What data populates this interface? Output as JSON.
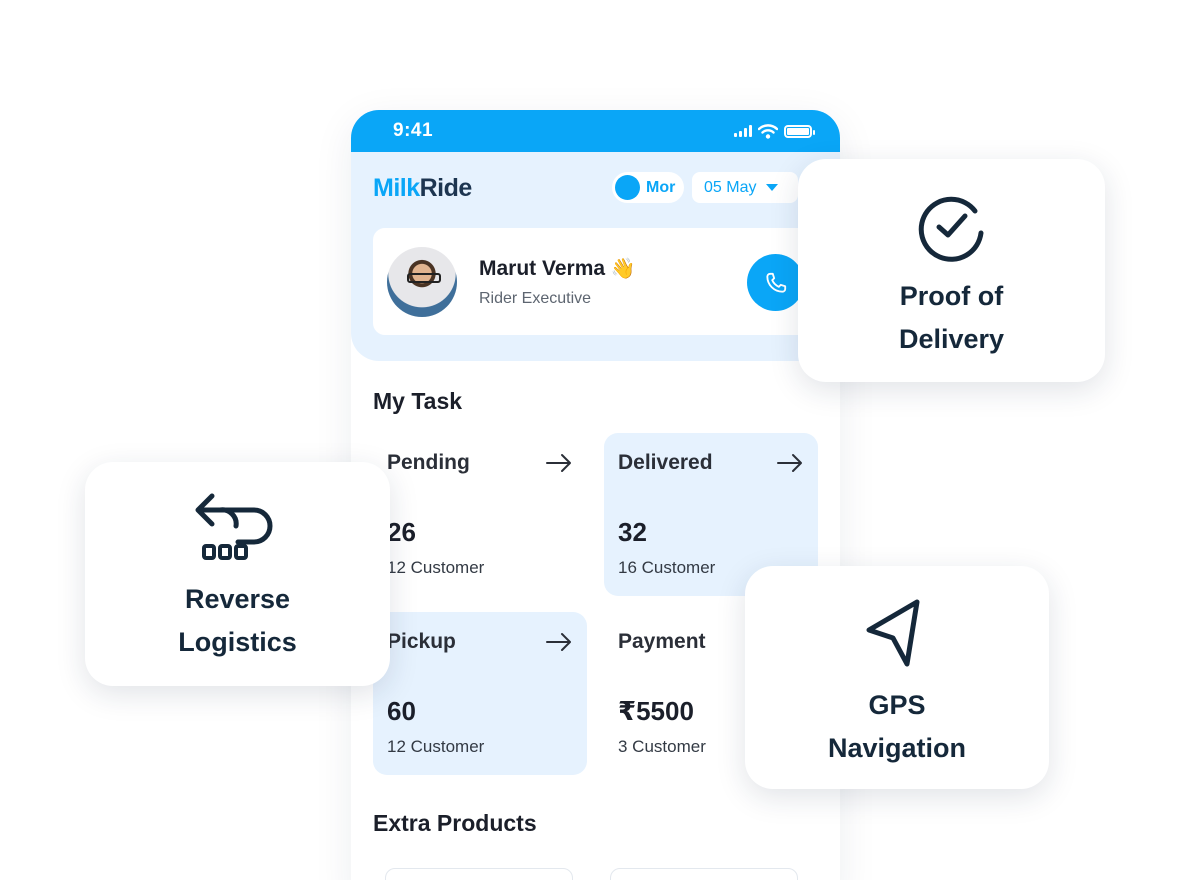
{
  "status_bar": {
    "time": "9:41"
  },
  "app": {
    "logo_part1": "Milk",
    "logo_part2": "Ride",
    "shift_toggle": {
      "label": "Mor"
    },
    "date_select": {
      "value": "05 May"
    }
  },
  "profile": {
    "name": "Marut Verma",
    "wave": "👋",
    "role": "Rider Executive"
  },
  "my_task": {
    "title": "My Task",
    "tiles": [
      {
        "label": "Pending",
        "value": "26",
        "sub": "12 Customer",
        "highlighted": false
      },
      {
        "label": "Delivered",
        "value": "32",
        "sub": "16 Customer",
        "highlighted": true
      },
      {
        "label": "Pickup",
        "value": "60",
        "sub": "12 Customer",
        "highlighted": true
      },
      {
        "label": "Payment",
        "value": "₹5500",
        "sub": "3 Customer",
        "highlighted": false
      }
    ]
  },
  "extra_products": {
    "title": "Extra Products"
  },
  "features": {
    "proof_of_delivery": {
      "line1": "Proof of",
      "line2": "Delivery",
      "icon": "check-circle-icon"
    },
    "reverse_logistics": {
      "line1": "Reverse",
      "line2": "Logistics",
      "icon": "return-arrow-icon"
    },
    "gps_navigation": {
      "line1": "GPS",
      "line2": "Navigation",
      "icon": "navigation-arrow-icon"
    }
  },
  "colors": {
    "accent": "#0aa6f7",
    "light_tint": "#e6f2fe",
    "dark_text": "#15283a"
  }
}
